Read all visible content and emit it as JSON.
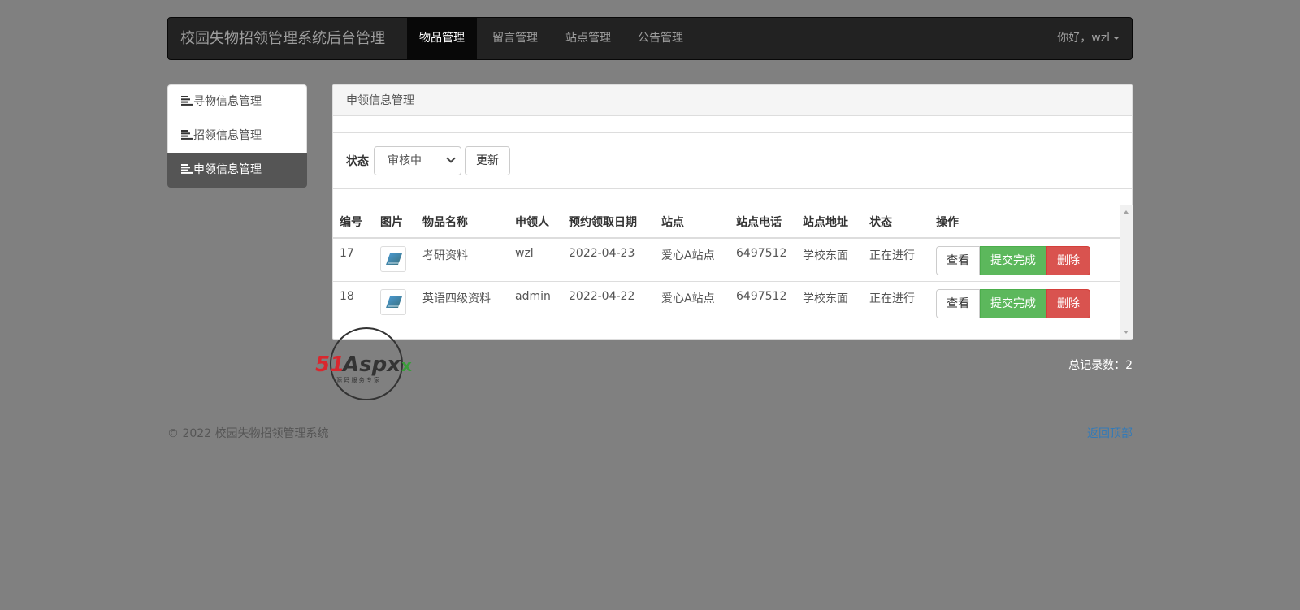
{
  "navbar": {
    "brand": "校园失物招领管理系统后台管理",
    "items": [
      {
        "label": "物品管理",
        "active": true
      },
      {
        "label": "留言管理",
        "active": false
      },
      {
        "label": "站点管理",
        "active": false
      },
      {
        "label": "公告管理",
        "active": false
      }
    ],
    "user_label": "你好，wzl"
  },
  "sidebar": {
    "items": [
      {
        "label": "寻物信息管理"
      },
      {
        "label": "招领信息管理"
      },
      {
        "label": "申领信息管理"
      }
    ]
  },
  "panel": {
    "title": "申领信息管理",
    "filter": {
      "label": "状态",
      "selected": "审核中",
      "refresh_label": "更新"
    },
    "table": {
      "headers": [
        "编号",
        "图片",
        "物品名称",
        "申领人",
        "预约领取日期",
        "站点",
        "站点电话",
        "站点地址",
        "状态",
        "操作"
      ],
      "rows": [
        {
          "id": "17",
          "name": "考研资料",
          "claimant": "wzl",
          "date": "2022-04-23",
          "site": "爱心A站点",
          "phone": "6497512",
          "address": "学校东面",
          "status": "正在进行"
        },
        {
          "id": "18",
          "name": "英语四级资料",
          "claimant": "admin",
          "date": "2022-04-22",
          "site": "爱心A站点",
          "phone": "6497512",
          "address": "学校东面",
          "status": "正在进行"
        }
      ],
      "actions": {
        "view": "查看",
        "complete": "提交完成",
        "delete": "删除"
      }
    },
    "total": "总记录数：2"
  },
  "watermark": {
    "text": "51Aspx",
    "subtext": "源码服务专家"
  },
  "footer": {
    "copyright": "© 2022 校园失物招领管理系统",
    "back_to_top": "返回顶部"
  },
  "colors": {
    "navbar": "#222222",
    "success": "#5cb85c",
    "danger": "#d9534f",
    "link": "#337ab7"
  }
}
